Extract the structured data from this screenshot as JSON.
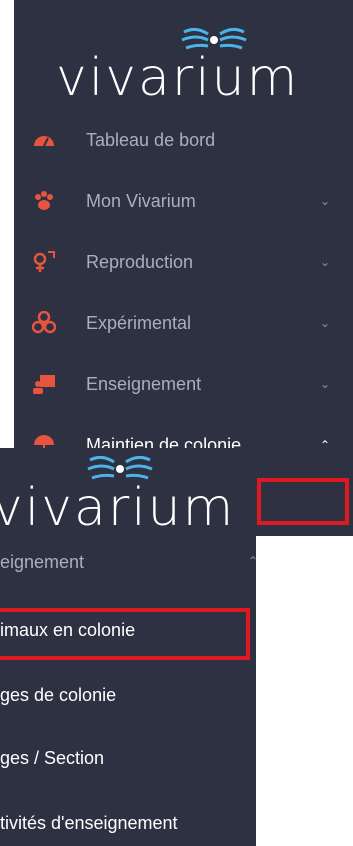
{
  "app": {
    "logo_text": "vivarium"
  },
  "sidebar": {
    "items": [
      {
        "label": "Tableau de bord",
        "icon": "dashboard-gauge-icon",
        "has_chevron": false
      },
      {
        "label": "Mon Vivarium",
        "icon": "paw-icon",
        "has_chevron": true,
        "chevron": "⌄"
      },
      {
        "label": "Reproduction",
        "icon": "gender-symbols-icon",
        "has_chevron": true,
        "chevron": "⌄"
      },
      {
        "label": "Expérimental",
        "icon": "biohazard-icon",
        "has_chevron": true,
        "chevron": "⌄"
      },
      {
        "label": "Enseignement",
        "icon": "teacher-board-icon",
        "has_chevron": true,
        "chevron": "⌄"
      },
      {
        "label": "Maintien de colonie",
        "icon": "umbrella-icon",
        "has_chevron": true,
        "chevron": "⌃"
      }
    ]
  },
  "submenu": {
    "section_label": "eignement",
    "section_chevron": "⌃",
    "items": [
      {
        "label": "imaux en colonie"
      },
      {
        "label": "ges de colonie"
      },
      {
        "label": "ges / Section"
      },
      {
        "label": "tivités d'enseignement"
      }
    ]
  },
  "colors": {
    "sidebar_bg": "#2d3142",
    "accent_icon": "#e8553e",
    "highlight": "#e0181f",
    "logo_rays": "#4ab3e8"
  }
}
